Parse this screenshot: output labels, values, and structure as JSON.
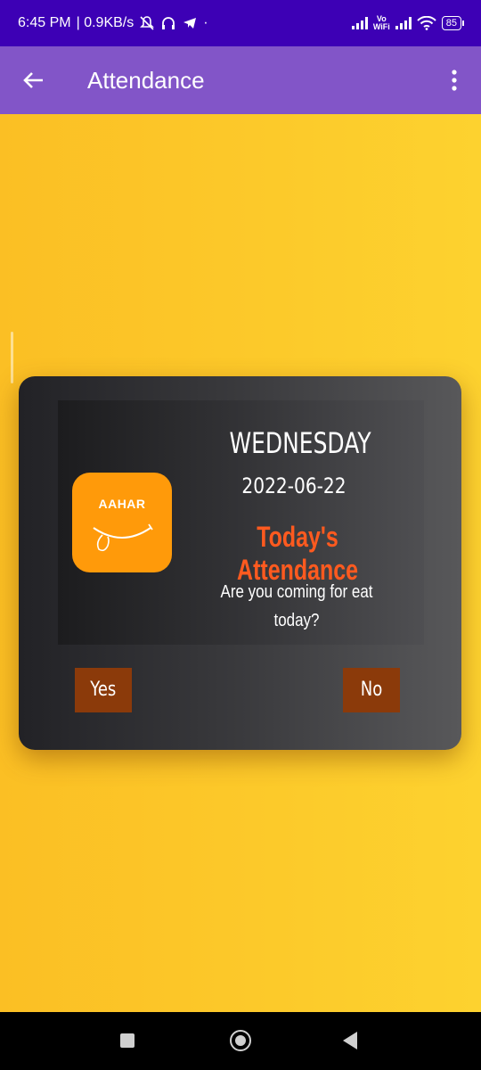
{
  "status_bar": {
    "time": "6:45 PM",
    "speed": "| 0.9KB/s",
    "battery": "85",
    "vowifi_top": "Vo",
    "vowifi_bottom": "WiFi"
  },
  "app_bar": {
    "title": "Attendance",
    "back_icon": "arrow-left-icon",
    "menu_icon": "more-vertical-icon",
    "background": "#8255c8"
  },
  "card": {
    "logo_text": "AAHAR",
    "day": "WEDNESDAY",
    "date": "2022-06-22",
    "heading": "Today's Attendance",
    "question": "Are you coming for eat today?",
    "yes_label": "Yes",
    "no_label": "No",
    "heading_color": "#ff5a1f",
    "button_color": "#8b3a0a",
    "logo_color": "#ff9a0a"
  },
  "nav_bar": {
    "icons": [
      "recents-icon",
      "home-icon",
      "back-icon"
    ]
  }
}
